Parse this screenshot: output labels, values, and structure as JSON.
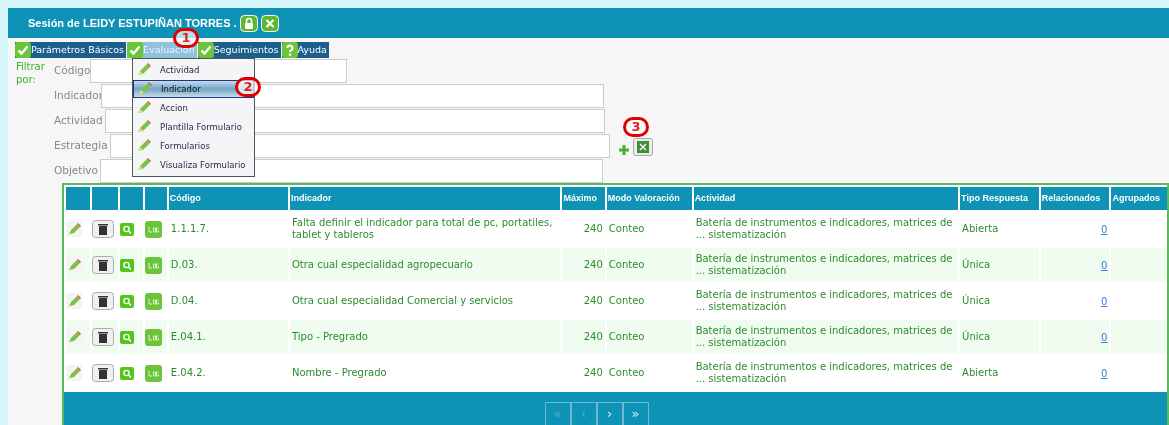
{
  "session": {
    "title": "Sesión de LEIDY ESTUPIÑAN TORRES ."
  },
  "menu": [
    {
      "label": "Parámetros Básicos",
      "kind": "check",
      "selected": false
    },
    {
      "label": "Evaluación",
      "kind": "check",
      "selected": true
    },
    {
      "label": "Seguimientos",
      "kind": "check",
      "selected": false
    },
    {
      "label": "Ayuda",
      "kind": "help",
      "selected": false
    }
  ],
  "dropdown": [
    {
      "label": "Actividad",
      "selected": false
    },
    {
      "label": "Indicador",
      "selected": true
    },
    {
      "label": "Accion",
      "selected": false
    },
    {
      "label": "Plantilla Formulario",
      "selected": false
    },
    {
      "label": "Formularios",
      "selected": false
    },
    {
      "label": "Visualiza Formulario",
      "selected": false
    }
  ],
  "filter": {
    "title": "Filtrar por:",
    "fields": [
      {
        "label": "Código"
      },
      {
        "label": "Indicador"
      },
      {
        "label": "Actividad"
      },
      {
        "label": "Estrategia"
      },
      {
        "label": "Objetivo"
      }
    ]
  },
  "annotations": [
    "1",
    "2",
    "3"
  ],
  "table": {
    "columns": [
      "Código",
      "Indicador",
      "Máximo",
      "Modo Valoración",
      "Actividad",
      "Tipo Respuesta",
      "Relacionados",
      "Agrupados"
    ],
    "rows": [
      {
        "code": "1.1.1.7.",
        "indicator": "Falta definir el indicador para total de pc, portatiles, tablet y tableros",
        "max": "240",
        "mode": "Conteo",
        "activity": "Batería de instrumentos e indicadores, matrices de ... sistematización",
        "response": "Abierta",
        "related": "0"
      },
      {
        "code": "D.03.",
        "indicator": "Otra cual especialidad agropecuario",
        "max": "240",
        "mode": "Conteo",
        "activity": "Batería de instrumentos e indicadores, matrices de ... sistematización",
        "response": "Única",
        "related": "0"
      },
      {
        "code": "D.04.",
        "indicator": "Otra cual especialidad Comercial y servicios",
        "max": "240",
        "mode": "Conteo",
        "activity": "Batería de instrumentos e indicadores, matrices de ... sistematización",
        "response": "Única",
        "related": "0"
      },
      {
        "code": "E.04.1.",
        "indicator": "Tipo - Pregrado",
        "max": "240",
        "mode": "Conteo",
        "activity": "Batería de instrumentos e indicadores, matrices de ... sistematización",
        "response": "Única",
        "related": "0"
      },
      {
        "code": "E.04.2.",
        "indicator": "Nombre - Pregrado",
        "max": "240",
        "mode": "Conteo",
        "activity": "Batería de instrumentos e indicadores, matrices de ... sistematización",
        "response": "Abierta",
        "related": "0"
      }
    ]
  },
  "pagination": [
    {
      "label": "«",
      "disabled": true
    },
    {
      "label": "‹",
      "disabled": true
    },
    {
      "label": "›",
      "disabled": false
    },
    {
      "label": "»",
      "disabled": false
    }
  ]
}
